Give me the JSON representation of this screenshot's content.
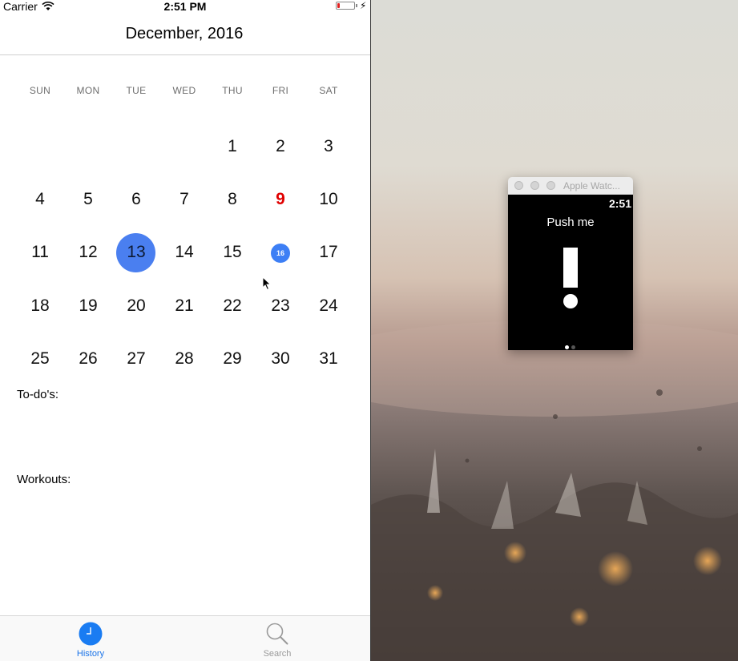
{
  "status_bar": {
    "carrier": "Carrier",
    "time": "2:51 PM",
    "battery_level": 0.15
  },
  "calendar": {
    "month_title": "December, 2016",
    "weekdays": [
      "SUN",
      "MON",
      "TUE",
      "WED",
      "THU",
      "FRI",
      "SAT"
    ],
    "weeks": [
      [
        "",
        "",
        "",
        "",
        "1",
        "2",
        "3"
      ],
      [
        "4",
        "5",
        "6",
        "7",
        "8",
        "9",
        "10"
      ],
      [
        "11",
        "12",
        "13",
        "14",
        "15",
        "16",
        "17"
      ],
      [
        "18",
        "19",
        "20",
        "21",
        "22",
        "23",
        "24"
      ],
      [
        "25",
        "26",
        "27",
        "28",
        "29",
        "30",
        "31"
      ]
    ],
    "selected_day": "13",
    "today_day": "16",
    "highlighted_day": "9",
    "colors": {
      "selected": "#4a7ff0",
      "today": "#3d7ff5",
      "highlight": "#e00000"
    }
  },
  "sections": {
    "todos_label": "To-do's:",
    "workouts_label": "Workouts:"
  },
  "tab_bar": {
    "history_label": "History",
    "search_label": "Search",
    "active_color": "#1a73e8",
    "inactive_color": "#9a9a9a",
    "history_icon": "clock-icon",
    "search_icon": "search-icon"
  },
  "watch": {
    "window_title": "Apple Watc...",
    "time": "2:51",
    "prompt": "Push me",
    "page_count": 2,
    "current_page": 0
  }
}
